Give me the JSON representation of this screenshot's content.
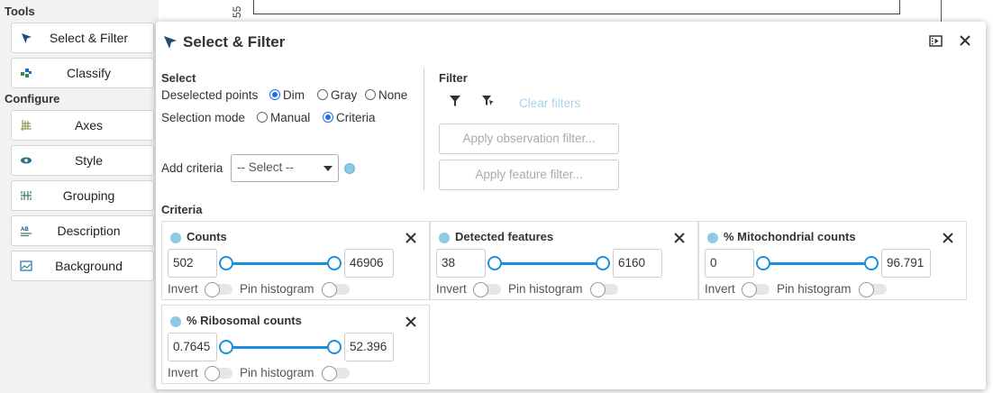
{
  "tools_panel": {
    "tools_heading": "Tools",
    "tool_items": [
      {
        "label": "Select & Filter",
        "icon": "cursor-arrow-icon"
      },
      {
        "label": "Classify",
        "icon": "classify-icon"
      }
    ],
    "configure_heading": "Configure",
    "configure_items": [
      {
        "label": "Axes",
        "icon": "axes-grid-icon"
      },
      {
        "label": "Style",
        "icon": "eye-icon"
      },
      {
        "label": "Grouping",
        "icon": "grouping-icon"
      },
      {
        "label": "Description",
        "icon": "description-icon"
      },
      {
        "label": "Background",
        "icon": "background-image-icon"
      }
    ]
  },
  "plot": {
    "axis_tick": "55"
  },
  "dialog": {
    "title": "Select & Filter",
    "select_section": {
      "heading": "Select",
      "deselected_points_label": "Deselected points",
      "deselected_options": [
        "Dim",
        "Gray",
        "None"
      ],
      "deselected_selected": "Dim",
      "selection_mode_label": "Selection mode",
      "selection_mode_options": [
        "Manual",
        "Criteria"
      ],
      "selection_mode_selected": "Criteria",
      "add_criteria_label": "Add criteria",
      "add_criteria_value": "-- Select --"
    },
    "filter_section": {
      "heading": "Filter",
      "clear_filters": "Clear filters",
      "apply_observation_filter": "Apply observation filter...",
      "apply_feature_filter": "Apply feature filter..."
    },
    "criteria_heading": "Criteria",
    "criteria": [
      {
        "title": "Counts",
        "min": "502",
        "max": "46906",
        "invert_label": "Invert",
        "pin_label": "Pin histogram"
      },
      {
        "title": "Detected features",
        "min": "38",
        "max": "6160",
        "invert_label": "Invert",
        "pin_label": "Pin histogram"
      },
      {
        "title": "% Mitochondrial counts",
        "min": "0",
        "max": "96.791",
        "invert_label": "Invert",
        "pin_label": "Pin histogram"
      },
      {
        "title": "% Ribosomal counts",
        "min": "0.7645",
        "max": "52.396",
        "invert_label": "Invert",
        "pin_label": "Pin histogram"
      }
    ]
  },
  "colors": {
    "accent": "#1a8fe0",
    "criteria_dot": "#8ecae6",
    "disabled_link": "#a8d3ef"
  }
}
